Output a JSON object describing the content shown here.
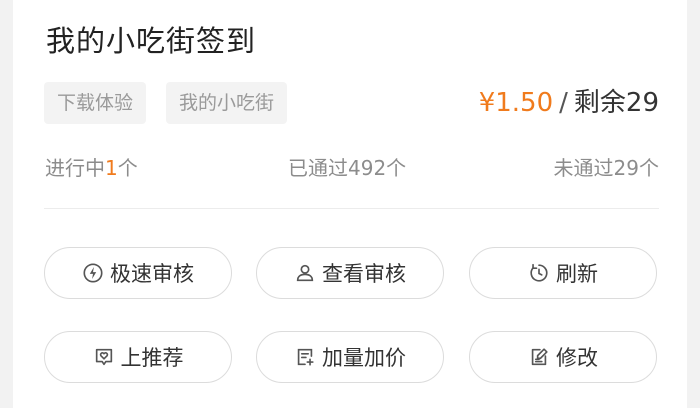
{
  "task": {
    "title": "我的小吃街签到",
    "tags": [
      "下载体验",
      "我的小吃街"
    ],
    "price": "¥1.50",
    "separator": "/",
    "remaining": "剩余29"
  },
  "stats": {
    "in_progress_prefix": "进行中",
    "in_progress_count": "1",
    "in_progress_suffix": "个",
    "passed": "已通过492个",
    "failed": "未通过29个"
  },
  "actions": {
    "fast_review": "极速审核",
    "view_review": "查看审核",
    "refresh": "刷新",
    "promote": "上推荐",
    "add_quantity_price": "加量加价",
    "edit": "修改"
  },
  "colors": {
    "accent": "#f07b1d",
    "text": "#333333",
    "muted": "#8c8c8c"
  },
  "icons": [
    "lightning-icon",
    "user-review-icon",
    "refresh-timer-icon",
    "heart-tag-icon",
    "list-add-icon",
    "edit-doc-icon"
  ]
}
